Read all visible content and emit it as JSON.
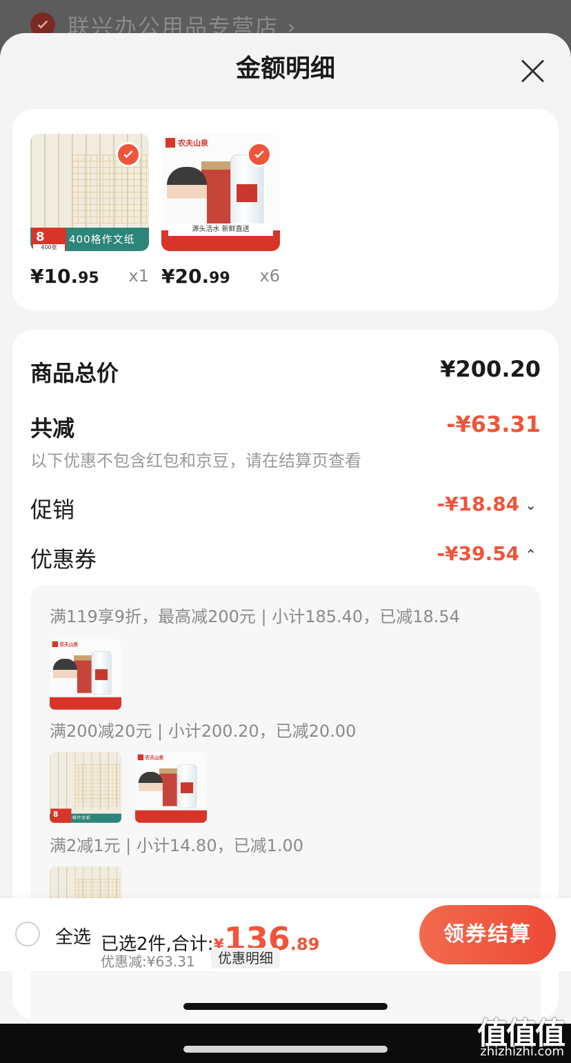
{
  "store": {
    "name": "联兴办公用品专营店 ›"
  },
  "sheet": {
    "title": "金额明细"
  },
  "products": [
    {
      "price_main": "¥10.",
      "price_dec": "95",
      "qty": "x1",
      "thumb": "paper",
      "band_text": "400格作文纸",
      "badge": "8",
      "badge_sub": "400张"
    },
    {
      "price_main": "¥20.",
      "price_dec": "99",
      "qty": "x6",
      "thumb": "water",
      "brand": "农夫山泉",
      "footer_text": "源头活水 新鲜直送"
    }
  ],
  "summary": {
    "total_label": "商品总价",
    "total_value": "¥200.20",
    "discount_label": "共减",
    "discount_value": "-¥63.31",
    "discount_note": "以下优惠不包含红包和京豆，请在结算页查看",
    "promo_label": "促销",
    "promo_value": "-¥18.84",
    "coupon_label": "优惠券",
    "coupon_value": "-¥39.54"
  },
  "coupons": [
    {
      "text": "满119享9折，最高减200元 | 小计185.40，已减18.54"
    },
    {
      "text": "满200减20元 | 小计200.20，已减20.00"
    },
    {
      "text": "满2减1元 | 小计14.80，已减1.00"
    }
  ],
  "bottom_bar": {
    "select_all": "全选",
    "selected_prefix": "已选2件,合计:",
    "yen": "¥",
    "total_int": "136",
    "total_dec": ".89",
    "saved": "优惠减:¥63.31",
    "detail_label": "优惠明细",
    "checkout_label": "领券结算"
  },
  "watermark": {
    "logo": "值值值",
    "site": "zhizhizhi.com"
  },
  "colors": {
    "accent": "#f0543a",
    "checkout_bg": "#ee4a36"
  }
}
